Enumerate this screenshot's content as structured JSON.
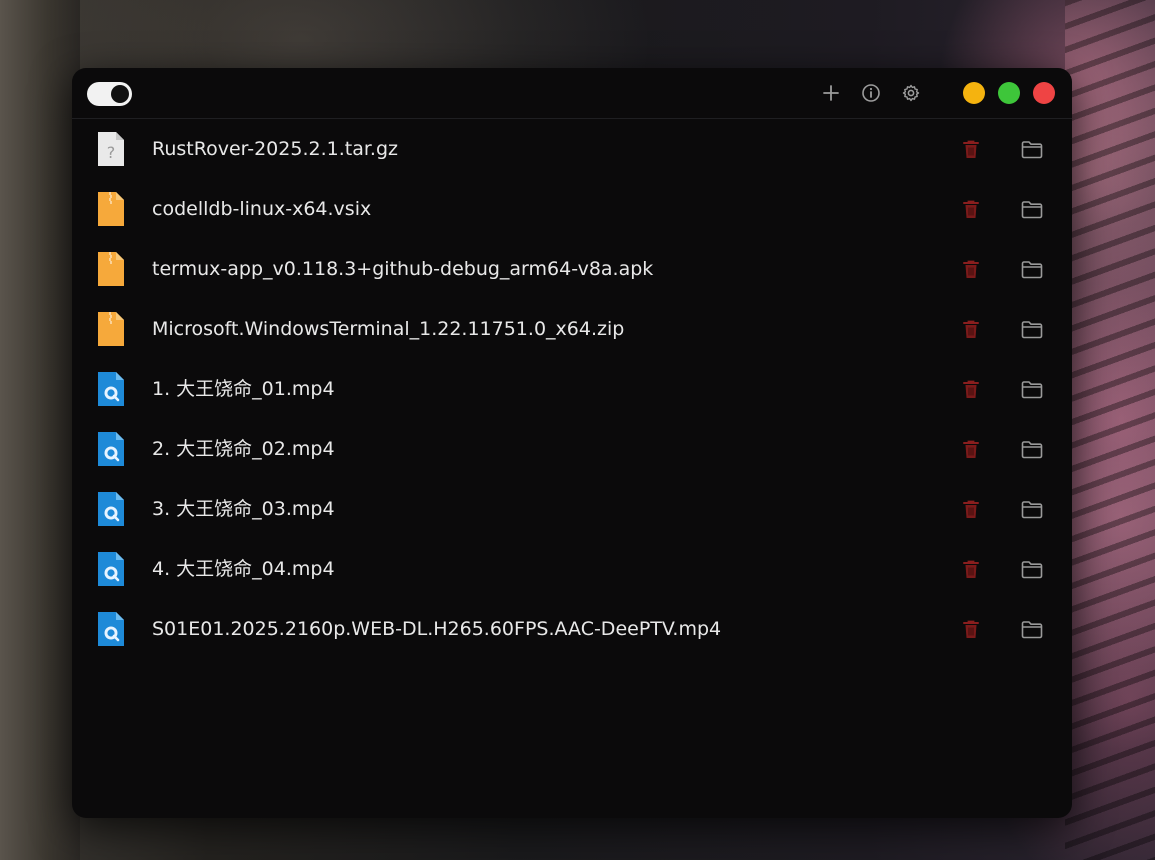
{
  "window": {
    "titlebar": {
      "toggle_state": "on",
      "icons": [
        "plus-icon",
        "info-icon",
        "gear-icon"
      ],
      "traffic_lights": [
        {
          "name": "minimize",
          "color": "#f5b30f"
        },
        {
          "name": "maximize",
          "color": "#3ec63a"
        },
        {
          "name": "close",
          "color": "#ef4444"
        }
      ]
    },
    "colors": {
      "background": "#0b0a0b",
      "text": "#e8e8e8",
      "trash": "#8a1e1e",
      "folder": "#9a9a9a"
    },
    "files": [
      {
        "name": "RustRover-2025.2.1.tar.gz",
        "type": "unknown"
      },
      {
        "name": "codelldb-linux-x64.vsix",
        "type": "archive"
      },
      {
        "name": "termux-app_v0.118.3+github-debug_arm64-v8a.apk",
        "type": "archive"
      },
      {
        "name": "Microsoft.WindowsTerminal_1.22.11751.0_x64.zip",
        "type": "archive"
      },
      {
        "name": "1. 大王饶命_01.mp4",
        "type": "video"
      },
      {
        "name": "2. 大王饶命_02.mp4",
        "type": "video"
      },
      {
        "name": "3. 大王饶命_03.mp4",
        "type": "video"
      },
      {
        "name": "4. 大王饶命_04.mp4",
        "type": "video"
      },
      {
        "name": "S01E01.2025.2160p.WEB-DL.H265.60FPS.AAC-DeePTV.mp4",
        "type": "video"
      }
    ]
  }
}
